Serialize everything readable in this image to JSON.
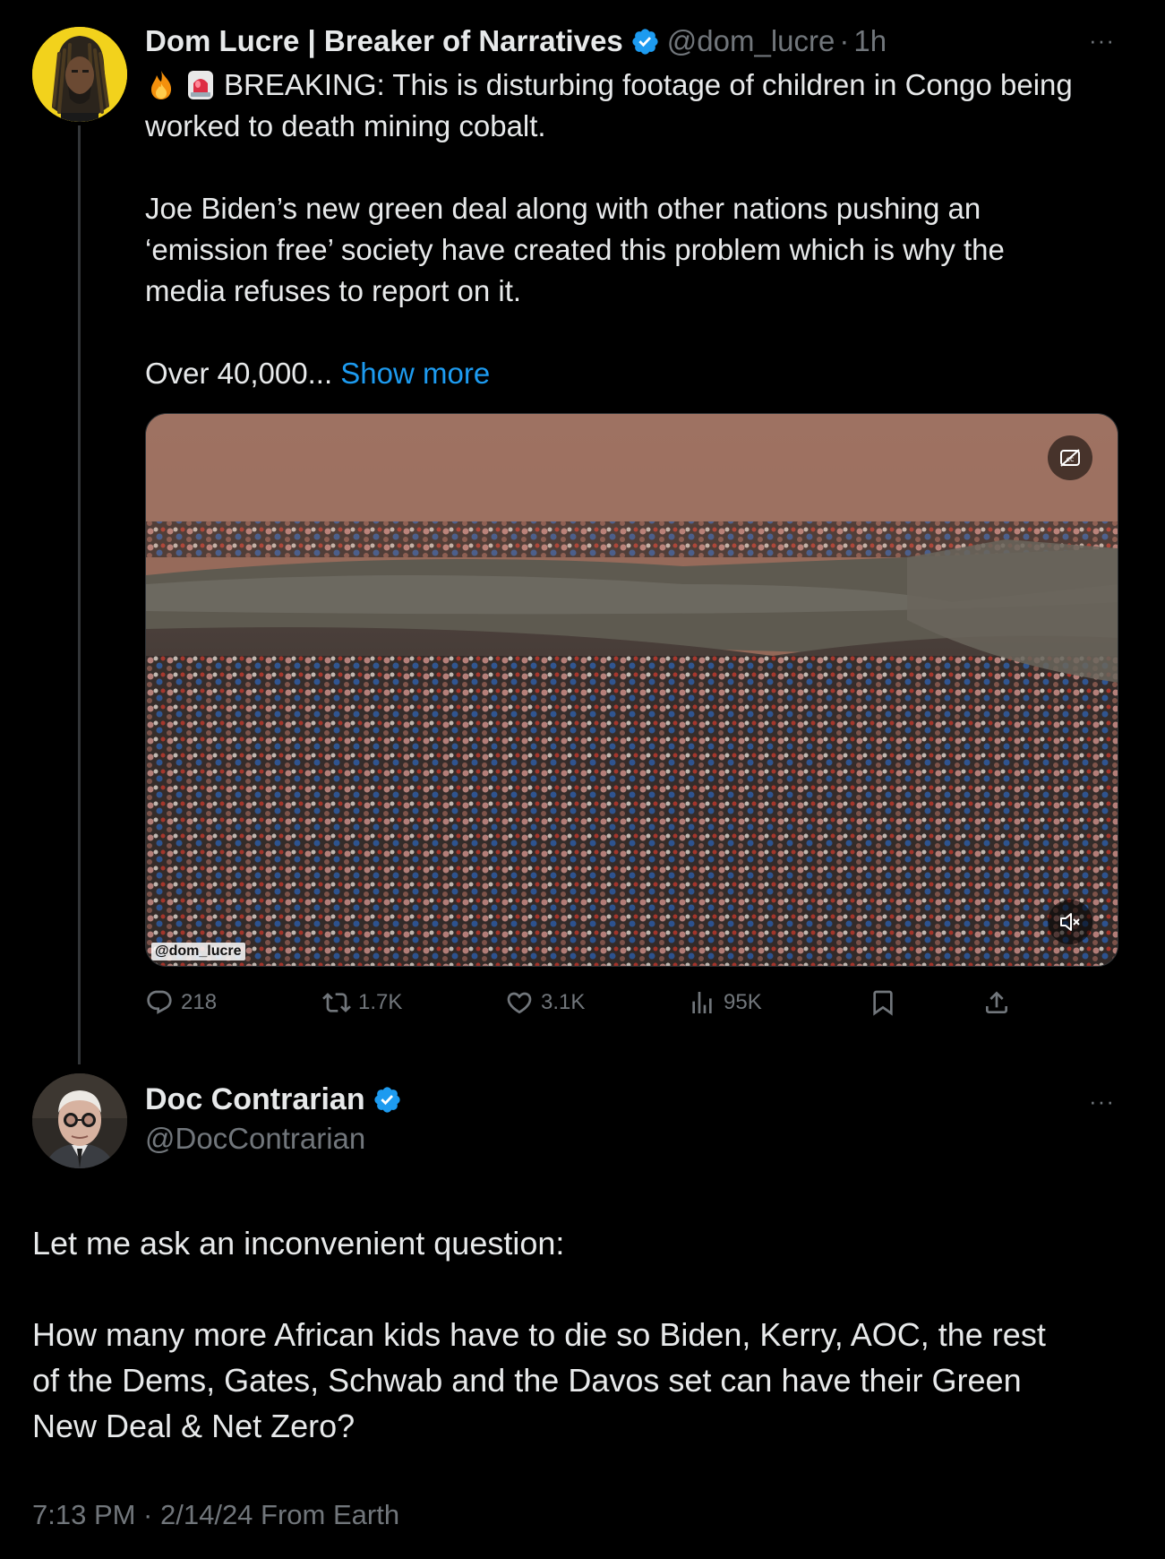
{
  "tweet1": {
    "author_name": "Dom Lucre | Breaker of Narratives",
    "handle": "@dom_lucre",
    "separator": "·",
    "time": "1h",
    "more": "···",
    "text_line1": "BREAKING: This is disturbing footage of children in Congo being",
    "text_line2": "worked to death mining cobalt.",
    "text_para2_line1": "Joe Biden’s new green deal along with other nations pushing an",
    "text_para2_line2": "‘emission free’ society have created this problem which is why the",
    "text_para2_line3": "media refuses to report on it.",
    "text_para3": "Over 40,000...",
    "show_more": "Show more",
    "emojis": [
      "fire-emoji",
      "police-light-emoji"
    ],
    "video_watermark": "@dom_lucre",
    "actions": {
      "replies": "218",
      "reposts": "1.7K",
      "likes": "3.1K",
      "views": "95K"
    }
  },
  "tweet2": {
    "author_name": "Doc Contrarian",
    "handle": "@DocContrarian",
    "more": "···",
    "text_para1": "Let me ask an inconvenient question:",
    "text_para2_line1": "How many more African kids have to die so Biden, Kerry, AOC, the rest",
    "text_para2_line2": "of the Dems, Gates, Schwab and the Davos set can have their Green",
    "text_para2_line3": "New Deal & Net Zero?",
    "timestamp": "7:13 PM · 2/14/24 From Earth"
  },
  "colors": {
    "background": "#000000",
    "text": "#e7e9ea",
    "muted": "#71767b",
    "link": "#1d9bf0",
    "verified": "#1d9bf0",
    "thread_line": "#333639"
  }
}
